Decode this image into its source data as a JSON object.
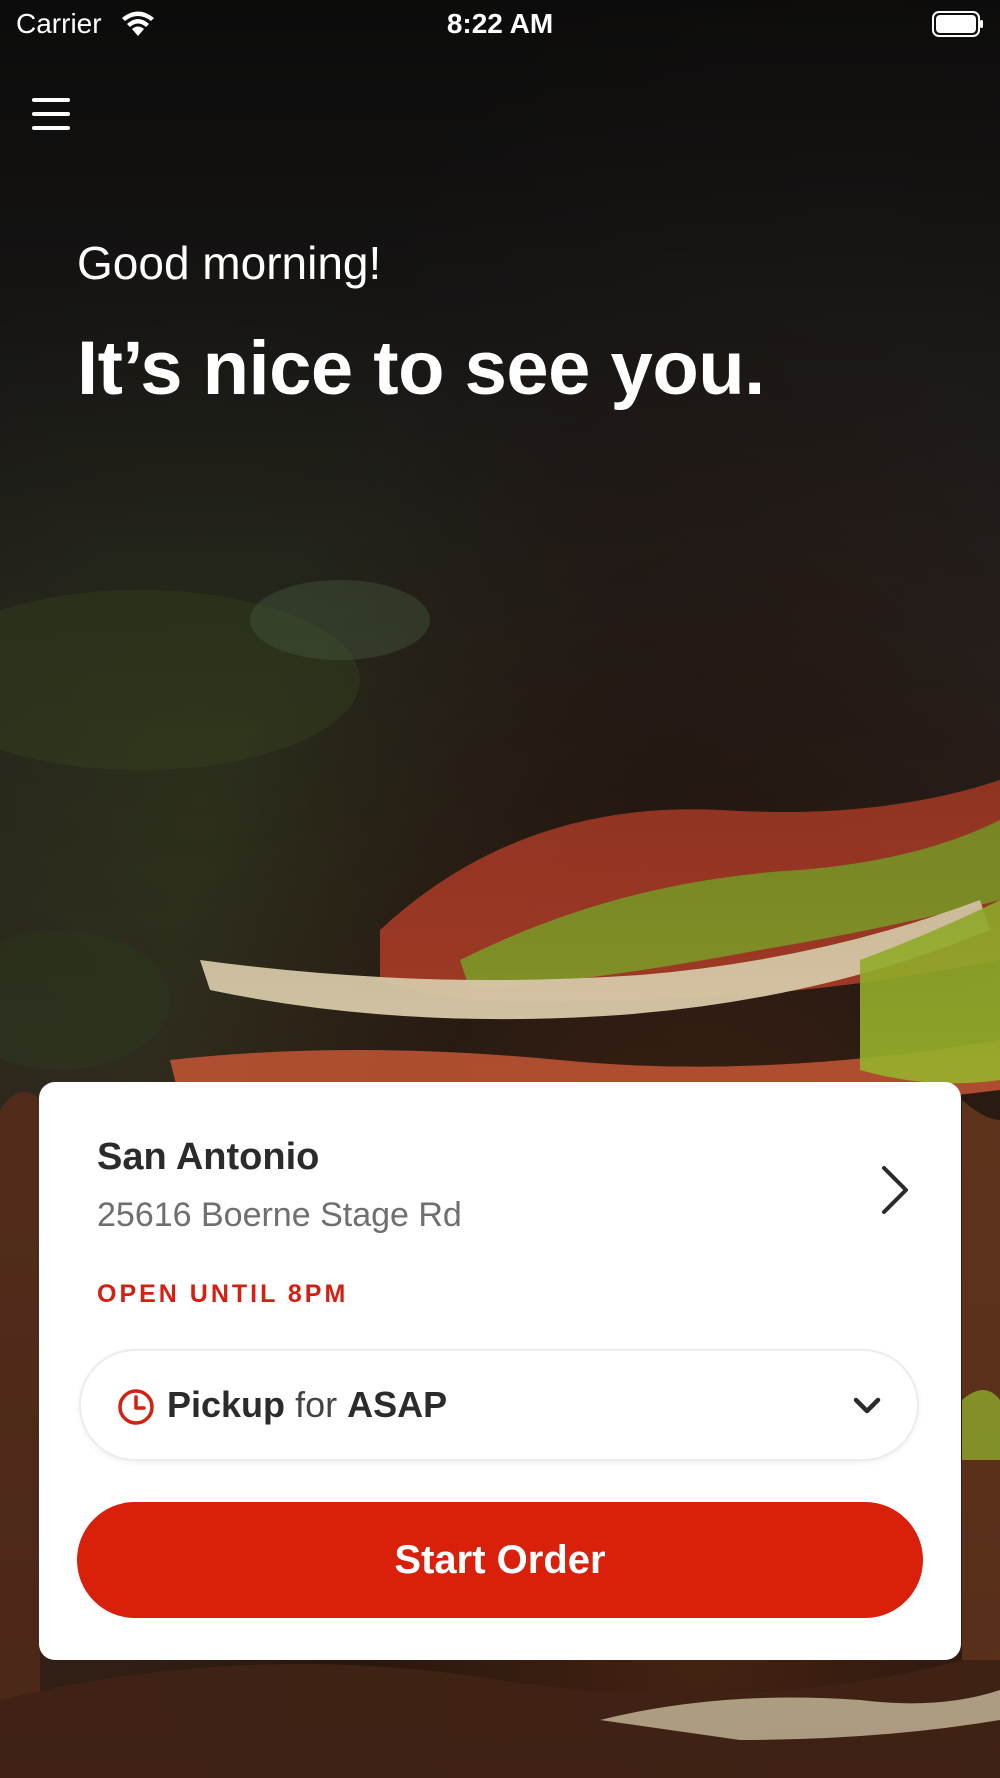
{
  "status_bar": {
    "carrier": "Carrier",
    "time": "8:22 AM"
  },
  "hero": {
    "greeting": "Good morning!",
    "headline": "It’s nice to see you."
  },
  "location_card": {
    "name": "San Antonio",
    "address": "25616 Boerne Stage Rd",
    "open_status": "OPEN UNTIL 8PM",
    "pickup": {
      "mode": "Pickup",
      "connector": "for",
      "time": "ASAP"
    },
    "start_order_label": "Start Order"
  },
  "colors": {
    "brand_red": "#d8200b",
    "status_red": "#d32011",
    "card_bg": "#ffffff",
    "text_dark": "#2b2b2b",
    "text_muted": "#6f6f6f"
  },
  "icons": {
    "menu": "hamburger-menu-icon",
    "wifi": "wifi-icon",
    "battery": "battery-icon",
    "location_chevron": "chevron-right-icon",
    "clock": "clock-icon",
    "dropdown": "chevron-down-icon"
  }
}
